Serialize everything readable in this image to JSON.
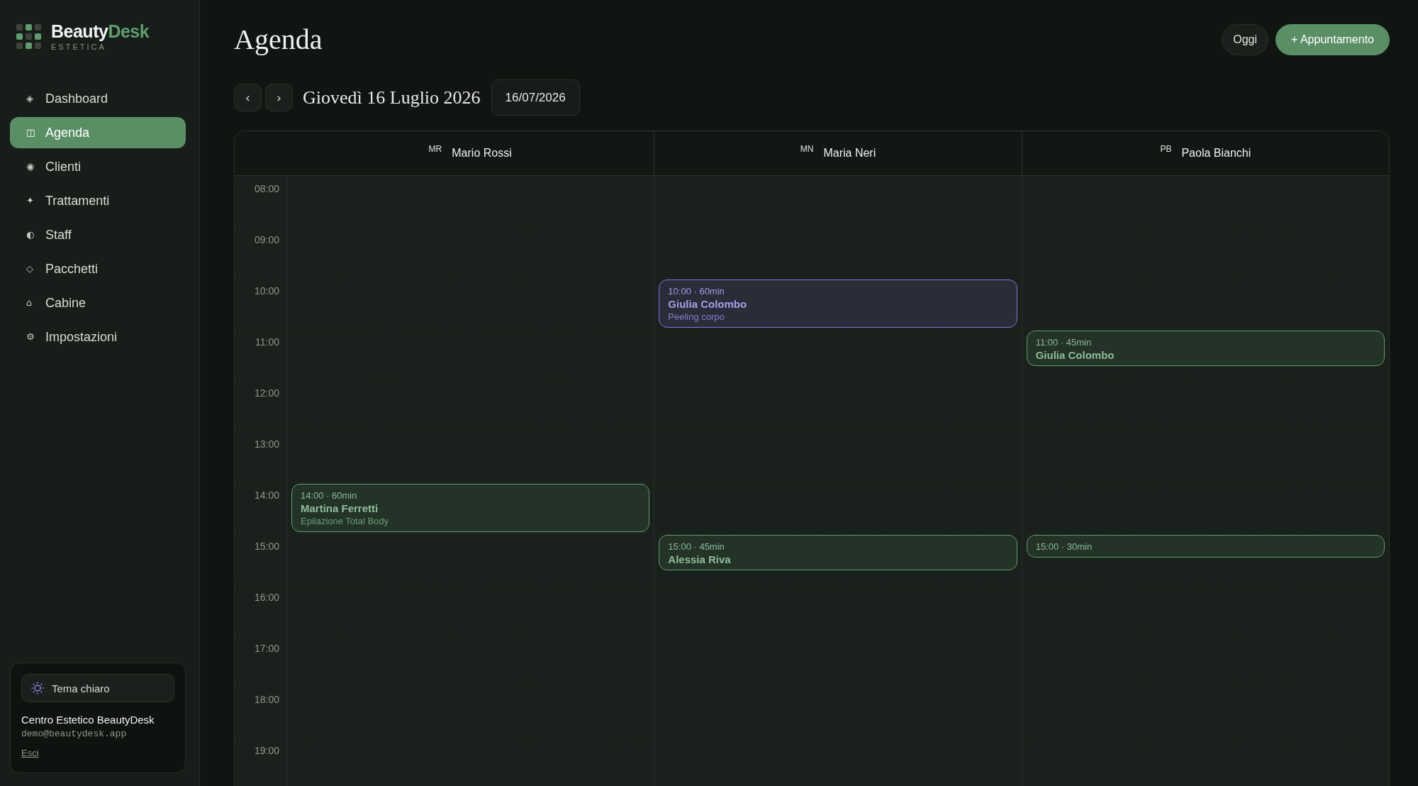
{
  "sidebar": {
    "brand": {
      "name_part_1": "Beauty",
      "name_part_2": "Desk",
      "tagline": "ESTETICA"
    },
    "nav_items": [
      {
        "icon": "◈",
        "label": "Dashboard",
        "selected": false
      },
      {
        "icon": "◫",
        "label": "Agenda",
        "selected": true
      },
      {
        "icon": "◉",
        "label": "Clienti",
        "selected": false
      },
      {
        "icon": "✦",
        "label": "Trattamenti",
        "selected": false
      },
      {
        "icon": "◐",
        "label": "Staff",
        "selected": false
      },
      {
        "icon": "◇",
        "label": "Pacchetti",
        "selected": false
      },
      {
        "icon": "⌂",
        "label": "Cabine",
        "selected": false
      },
      {
        "icon": "⚙",
        "label": "Impostazioni",
        "selected": false
      }
    ],
    "account_card": {
      "theme_button": {
        "label": "Tema chiaro"
      },
      "business_name": "Centro Estetico BeautyDesk",
      "email": "demo@beautydesk.app",
      "logout_link": "Esci"
    }
  },
  "header": {
    "title": "Agenda",
    "buttons": [
      {
        "label": "Oggi",
        "kind": "secondary"
      },
      {
        "label": "+ Appuntamento",
        "kind": "primary"
      }
    ]
  },
  "date_bar": {
    "prev_button": "‹",
    "next_button": "›",
    "date_label": "Giovedì 16 Luglio 2026",
    "date_field": {
      "value": "16/07/2026"
    }
  },
  "calendar": {
    "hours": [
      "08:00",
      "09:00",
      "10:00",
      "11:00",
      "12:00",
      "13:00",
      "14:00",
      "15:00",
      "16:00",
      "17:00",
      "18:00",
      "19:00"
    ],
    "columns": [
      {
        "initials": "MR",
        "name": "Mario Rossi",
        "events": [
          {
            "time": "14:00 · 60min",
            "client": "Martina Ferretti",
            "service": "Epilazione Total Body",
            "color": "#5f9e6e"
          }
        ]
      },
      {
        "initials": "MN",
        "name": "Maria Neri",
        "events": [
          {
            "time": "10:00 · 60min",
            "client": "Giulia Colombo",
            "service": "Peeling corpo",
            "color": "#8274e0"
          },
          {
            "time": "15:00 · 45min",
            "client": "Alessia Riva",
            "color": "#5f9e6e"
          }
        ]
      },
      {
        "initials": "PB",
        "name": "Paola Bianchi",
        "events": [
          {
            "time": "11:00 · 45min",
            "client": "Giulia Colombo",
            "color": "#5f9e6e"
          },
          {
            "time": "15:00 · 30min",
            "color": "#5f9e6e"
          }
        ]
      }
    ]
  }
}
